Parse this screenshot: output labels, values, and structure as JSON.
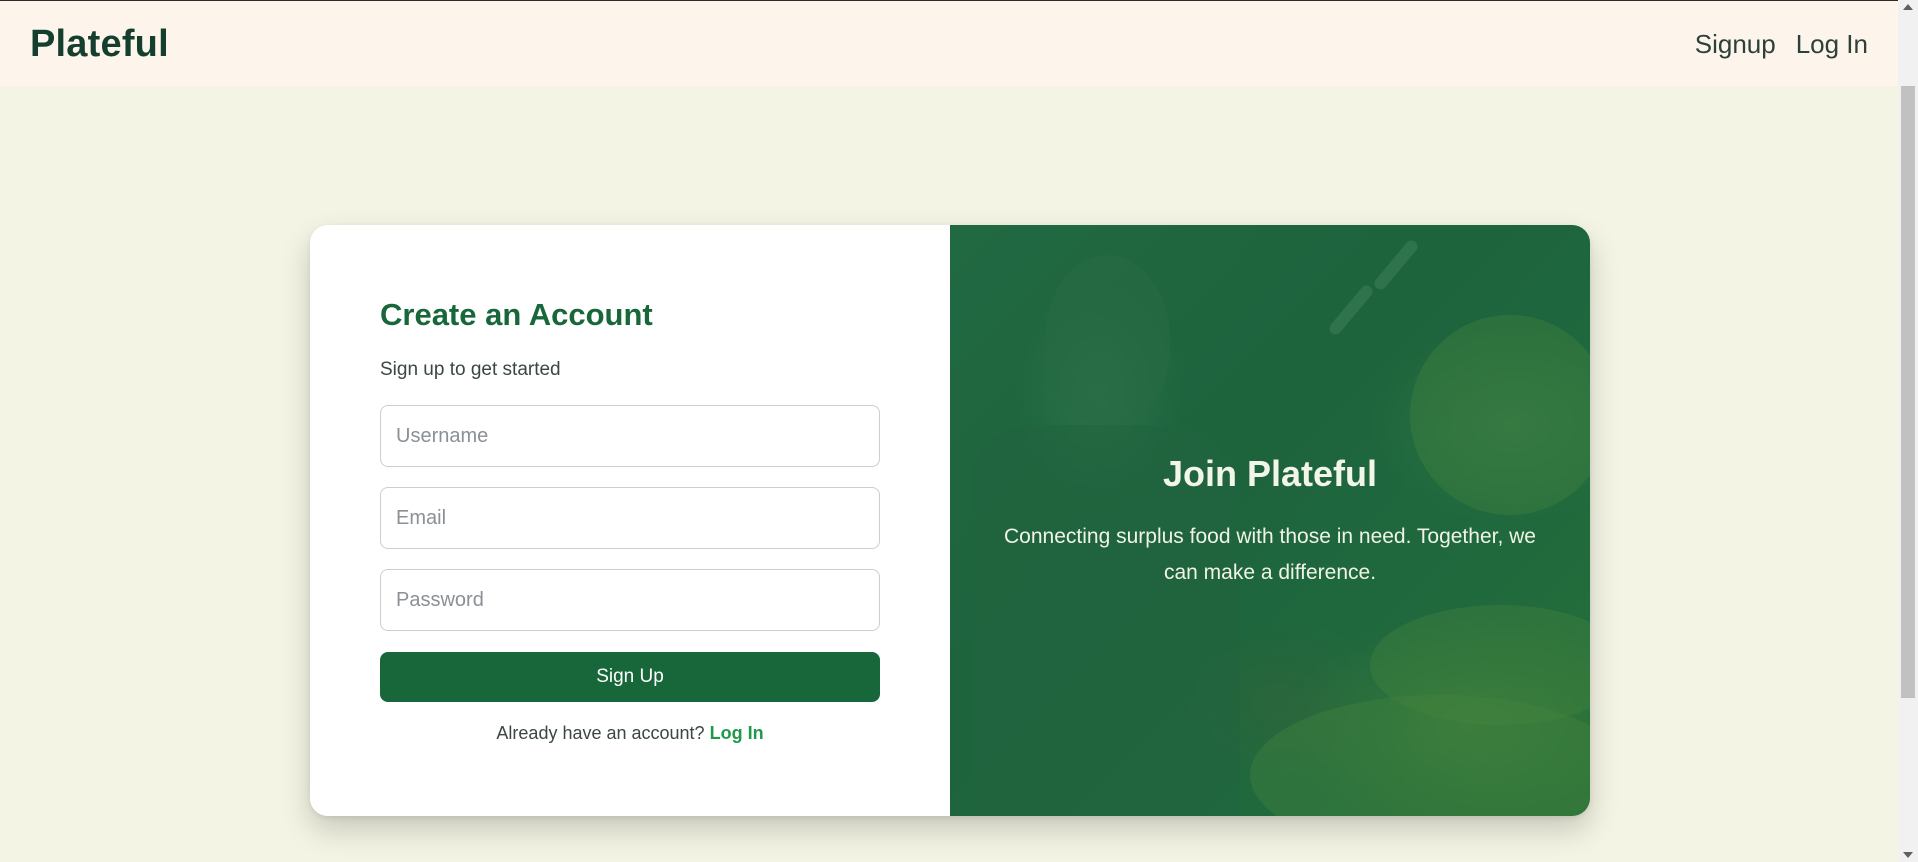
{
  "navbar": {
    "brand": "Plateful",
    "links": [
      "Signup",
      "Log In"
    ]
  },
  "form": {
    "title": "Create an Account",
    "subtitle": "Sign up to get started",
    "username_placeholder": "Username",
    "username_value": "",
    "email_placeholder": "Email",
    "email_value": "",
    "password_placeholder": "Password",
    "password_value": "",
    "submit_label": "Sign Up",
    "login_prompt": "Already have an account?",
    "login_link": "Log In"
  },
  "promo": {
    "title": "Join Plateful",
    "text": "Connecting surplus food with those in need. Together, we can make a difference.",
    "image_alt": "person inspecting produce in a grocery store"
  },
  "colors": {
    "page_background": "#f4f4e4",
    "navbar_background": "#fdf5ec",
    "brand": "#143f2e",
    "accent_green": "#18673a",
    "link_green": "#1f9a4a"
  }
}
